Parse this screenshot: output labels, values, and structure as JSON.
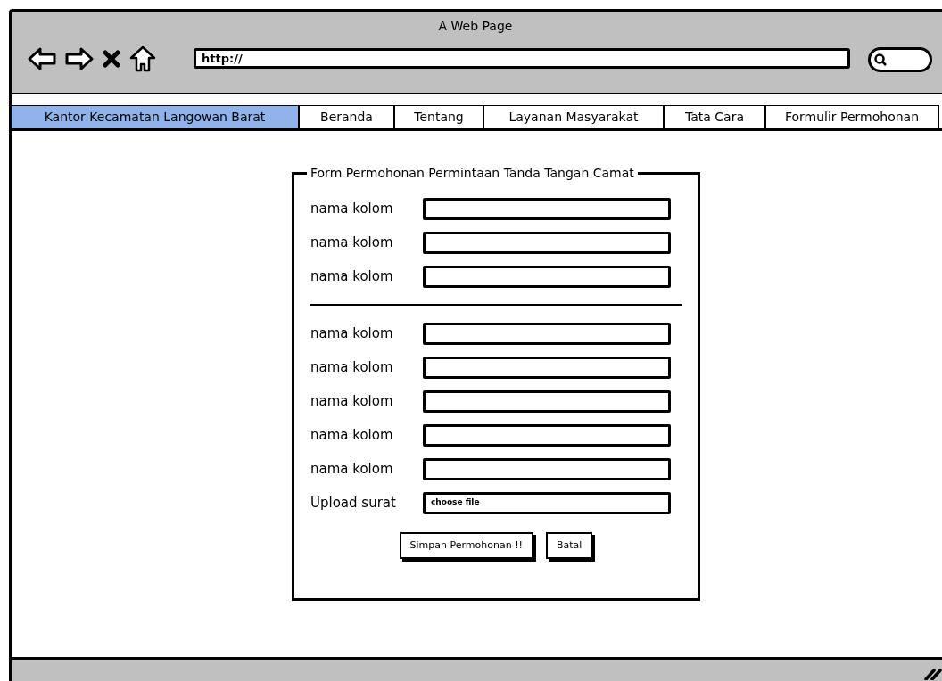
{
  "window": {
    "title": "A Web Page"
  },
  "address_bar": {
    "value": "http://"
  },
  "nav_tabs": [
    {
      "label": "Kantor Kecamatan Langowan Barat",
      "selected": true
    },
    {
      "label": "Beranda",
      "selected": false
    },
    {
      "label": "Tentang",
      "selected": false
    },
    {
      "label": "Layanan Masyarakat",
      "selected": false
    },
    {
      "label": "Tata Cara",
      "selected": false
    },
    {
      "label": "Formulir Permohonan",
      "selected": false
    }
  ],
  "form": {
    "legend": "Form Permohonan Permintaan Tanda Tangan Camat",
    "field_groups": [
      [
        {
          "label": "nama kolom"
        },
        {
          "label": "nama kolom"
        },
        {
          "label": "nama kolom"
        }
      ],
      [
        {
          "label": "nama kolom"
        },
        {
          "label": "nama kolom"
        },
        {
          "label": "nama kolom"
        },
        {
          "label": "nama kolom"
        },
        {
          "label": "nama kolom"
        }
      ]
    ],
    "upload": {
      "label": "Upload surat",
      "button": "choose file"
    },
    "buttons": [
      {
        "label": "Simpan Permohonan !!"
      },
      {
        "label": "Batal"
      }
    ]
  }
}
